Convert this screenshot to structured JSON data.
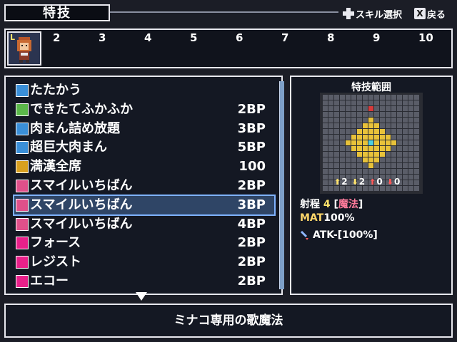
{
  "header": {
    "title": "特技",
    "skill_select_label": "スキル選択",
    "back_label": "戻る",
    "back_key": "X"
  },
  "party": {
    "slot1_badge": "L",
    "slots": [
      "2",
      "3",
      "4",
      "5",
      "6",
      "7",
      "8",
      "9",
      "10"
    ]
  },
  "skills": [
    {
      "name": "たたかう",
      "cost": "",
      "icon": "attack-icon",
      "color": "#3a8fd8"
    },
    {
      "name": "できたてふかふか",
      "cost": "2BP",
      "icon": "heal-plus-icon",
      "color": "#5bb84a"
    },
    {
      "name": "肉まん詰め放題",
      "cost": "3BP",
      "icon": "square-icon",
      "color": "#3a8fd8"
    },
    {
      "name": "超巨大肉まん",
      "cost": "5BP",
      "icon": "square-icon",
      "color": "#3a8fd8"
    },
    {
      "name": "満漢全席",
      "cost": "100",
      "icon": "feast-icon",
      "color": "#d8a020"
    },
    {
      "name": "スマイルいちばん",
      "cost": "2BP",
      "icon": "music-note-icon",
      "color": "#e0508a"
    },
    {
      "name": "スマイルいちばん",
      "cost": "3BP",
      "icon": "music-plus1-icon",
      "color": "#e0508a"
    },
    {
      "name": "スマイルいちばん",
      "cost": "4BP",
      "icon": "music-plus2-icon",
      "color": "#e0508a"
    },
    {
      "name": "フォース",
      "cost": "2BP",
      "icon": "vo-icon",
      "color": "#e8208a"
    },
    {
      "name": "レジスト",
      "cost": "2BP",
      "icon": "vo-icon",
      "color": "#e8208a"
    },
    {
      "name": "エコー",
      "cost": "2BP",
      "icon": "vo-icon",
      "color": "#e8208a"
    }
  ],
  "selected_index": 6,
  "range_panel": {
    "title": "特技範囲",
    "stat_shifts": [
      "2",
      "2",
      "0",
      "0"
    ],
    "range_label": "射程",
    "range_value": "4",
    "range_type_open": "[",
    "range_type": "魔法",
    "range_type_close": "]",
    "mat_label": "MAT",
    "mat_value": "100%",
    "atk_text": "ATK-[100%]"
  },
  "description": "ミナコ専用の歌魔法",
  "colors": {
    "highlight": "#ffe36b",
    "target_cell": "#e8c23a",
    "center_cell": "#4fd0e0",
    "origin_cell": "#d83a3a"
  }
}
